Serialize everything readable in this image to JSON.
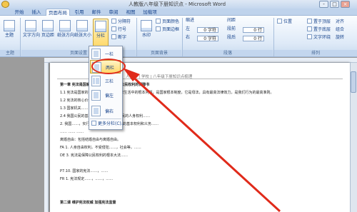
{
  "window": {
    "title": "人教版八年级下册知识点 - Microsoft Word",
    "controls": [
      "-",
      "□",
      "×"
    ]
  },
  "tabs": [
    "开始",
    "插入",
    "页面布局",
    "引用",
    "邮件",
    "审阅",
    "视图",
    "加载项"
  ],
  "ribbon": {
    "theme_group": {
      "label": "主题",
      "button": "主题"
    },
    "page_setup": {
      "label": "页面设置",
      "buttons": [
        "文字方向",
        "页边距",
        "纸张方向",
        "纸张大小",
        "分栏"
      ],
      "small": [
        "分隔符",
        "行号",
        "断字"
      ]
    },
    "background": {
      "label": "页面背景",
      "buttons": [
        "水印",
        "页面颜色",
        "页面边框"
      ]
    },
    "paragraph": {
      "label": "段落",
      "indent_title": "缩进",
      "spacing_title": "间距",
      "left_label": "左",
      "right_label": "右",
      "before_label": "段前",
      "after_label": "段后",
      "left_value": "0 字符",
      "right_value": "0 字符",
      "before_value": "0 行",
      "after_value": "0 行"
    },
    "arrange": {
      "label": "排列",
      "buttons": [
        "位置",
        "置于顶层",
        "置于底层",
        "文字环绕"
      ],
      "small": [
        "对齐",
        "组合",
        "旋转"
      ]
    }
  },
  "columns_menu": {
    "items": [
      "一栏",
      "两栏",
      "三栏",
      "偏左",
      "偏右"
    ],
    "more": "更多分栏(C)...",
    "highlighted": "两栏"
  },
  "document": {
    "header": "人教版 | 学校 | 八年级下册知识点梳理",
    "lines": [
      "第一章 宪法是国家的根本大法           第一课 公民权利的保障书",
      "1.1 宪法是国家的根本大法，它规定国家生活中的根本问题，是国家根本制度，它是母法，具有最高法律效力，是我们行为的最高准则。",
      "1.2 宪法的核心价值在于……",
      "1.3 国家机关……",
      "2.4 我国公民的基本权利和义务……                   公民的人身权利……",
      "     2. 我国……，实行……                                          。宪法规定公民的基本权利和义务……",
      "     ……         ……            ……",
      "离婚自由：包括结婚自由与离婚自由。",
      "FA 1. 人身自由权利，不受侵犯……，社会等，……",
      "DE 3. 宪法是保障公民权利的根本大法……",
      "P7.10. 国家的宪法……，……",
      "FR 1. 宪法规定……，……，……",
      "第二课 维护宪法权威 加强宪法监督"
    ]
  },
  "colors": {
    "accent": "#e02a1a",
    "ribbon": "#dde9f7",
    "highlight": "#ffd96b"
  }
}
